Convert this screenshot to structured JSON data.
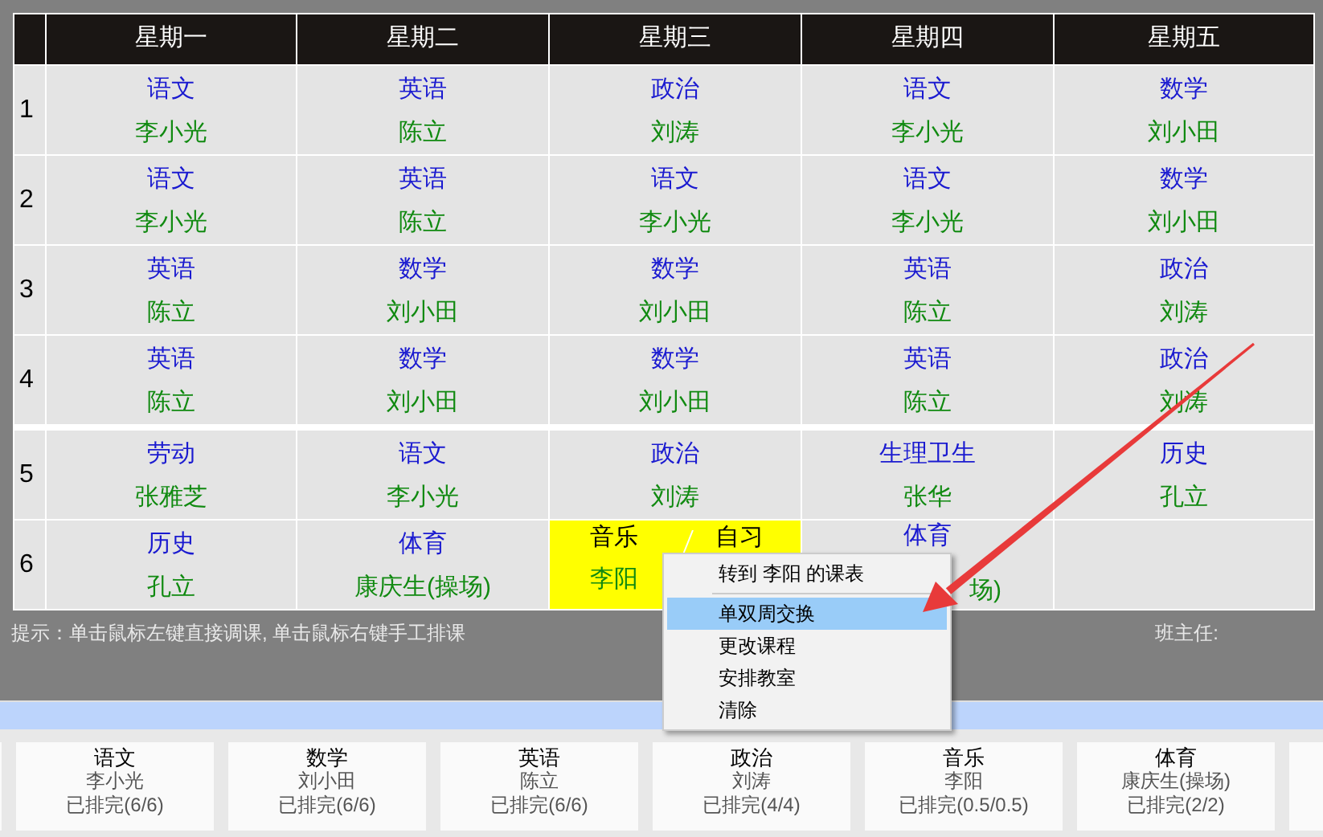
{
  "table": {
    "columns": [
      "星期一",
      "星期二",
      "星期三",
      "星期四",
      "星期五"
    ],
    "row_groups": [
      [
        {
          "period": "1",
          "cells": [
            {
              "kind": "lesson",
              "subject": "语文",
              "teacher": "李小光"
            },
            {
              "kind": "lesson",
              "subject": "英语",
              "teacher": "陈立"
            },
            {
              "kind": "lesson",
              "subject": "政治",
              "teacher": "刘涛"
            },
            {
              "kind": "lesson",
              "subject": "语文",
              "teacher": "李小光"
            },
            {
              "kind": "lesson",
              "subject": "数学",
              "teacher": "刘小田"
            }
          ]
        },
        {
          "period": "2",
          "cells": [
            {
              "kind": "lesson",
              "subject": "语文",
              "teacher": "李小光"
            },
            {
              "kind": "lesson",
              "subject": "英语",
              "teacher": "陈立"
            },
            {
              "kind": "lesson",
              "subject": "语文",
              "teacher": "李小光"
            },
            {
              "kind": "lesson",
              "subject": "语文",
              "teacher": "李小光"
            },
            {
              "kind": "lesson",
              "subject": "数学",
              "teacher": "刘小田"
            }
          ]
        },
        {
          "period": "3",
          "cells": [
            {
              "kind": "lesson",
              "subject": "英语",
              "teacher": "陈立"
            },
            {
              "kind": "lesson",
              "subject": "数学",
              "teacher": "刘小田"
            },
            {
              "kind": "lesson",
              "subject": "数学",
              "teacher": "刘小田"
            },
            {
              "kind": "lesson",
              "subject": "英语",
              "teacher": "陈立"
            },
            {
              "kind": "lesson",
              "subject": "政治",
              "teacher": "刘涛"
            }
          ]
        },
        {
          "period": "4",
          "cells": [
            {
              "kind": "lesson",
              "subject": "英语",
              "teacher": "陈立"
            },
            {
              "kind": "lesson",
              "subject": "数学",
              "teacher": "刘小田"
            },
            {
              "kind": "lesson",
              "subject": "数学",
              "teacher": "刘小田"
            },
            {
              "kind": "lesson",
              "subject": "英语",
              "teacher": "陈立"
            },
            {
              "kind": "lesson",
              "subject": "政治",
              "teacher": "刘涛"
            }
          ]
        }
      ],
      [
        {
          "period": "5",
          "cells": [
            {
              "kind": "lesson",
              "subject": "劳动",
              "teacher": "张雅芝"
            },
            {
              "kind": "lesson",
              "subject": "语文",
              "teacher": "李小光"
            },
            {
              "kind": "lesson",
              "subject": "政治",
              "teacher": "刘涛"
            },
            {
              "kind": "lesson",
              "subject": "生理卫生",
              "teacher": "张华"
            },
            {
              "kind": "lesson",
              "subject": "历史",
              "teacher": "孔立"
            }
          ]
        },
        {
          "period": "6",
          "cells": [
            {
              "kind": "lesson",
              "subject": "历史",
              "teacher": "孔立"
            },
            {
              "kind": "lesson",
              "subject": "体育",
              "teacher": "康庆生(操场)"
            },
            {
              "kind": "split",
              "highlighted": true,
              "parts": [
                {
                  "subject": "音乐",
                  "teacher": "李阳"
                },
                {
                  "subject": "自习"
                }
              ]
            },
            {
              "kind": "covered_lesson",
              "subject": "体育",
              "teacher": "场)"
            },
            {
              "kind": "empty"
            }
          ]
        }
      ]
    ]
  },
  "hint": "提示：单击鼠标左键直接调课, 单击鼠标右键手工排课",
  "head_teacher_label": "班主任:",
  "context_menu": [
    {
      "label": "转到 李阳 的课表",
      "selected": false
    },
    {
      "kind": "separator"
    },
    {
      "label": "单双周交换",
      "selected": true
    },
    {
      "label": "更改课程",
      "selected": false
    },
    {
      "label": "安排教室",
      "selected": false
    },
    {
      "label": "清除",
      "selected": false
    }
  ],
  "course_cards": [
    {
      "subject": "语文",
      "teacher": "李小光",
      "status": "已排完(6/6)"
    },
    {
      "subject": "数学",
      "teacher": "刘小田",
      "status": "已排完(6/6)"
    },
    {
      "subject": "英语",
      "teacher": "陈立",
      "status": "已排完(6/6)"
    },
    {
      "subject": "政治",
      "teacher": "刘涛",
      "status": "已排完(4/4)"
    },
    {
      "subject": "音乐",
      "teacher": "李阳",
      "status": "已排完(0.5/0.5)"
    },
    {
      "subject": "体育",
      "teacher": "康庆生(操场)",
      "status": "已排完(2/2)"
    }
  ]
}
